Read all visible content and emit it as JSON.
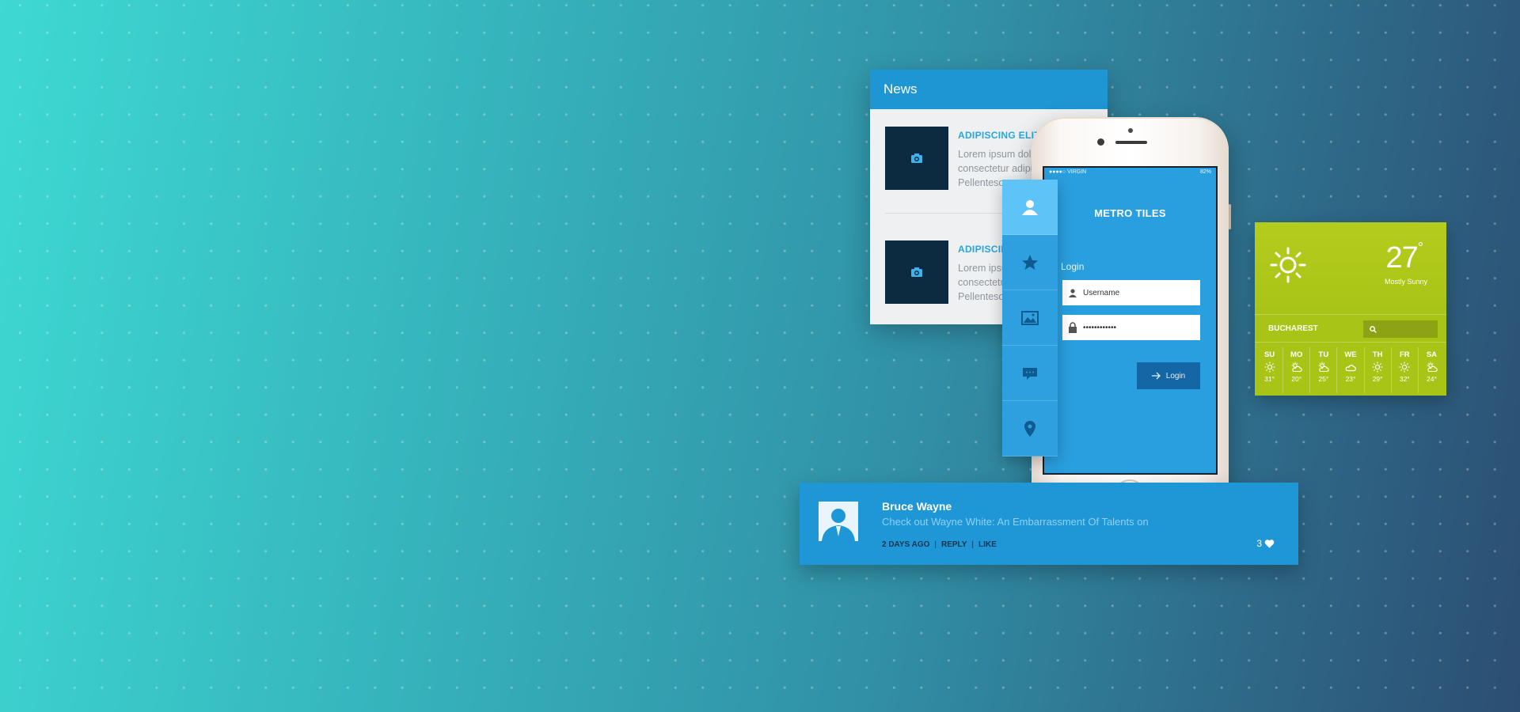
{
  "news": {
    "header": "News",
    "items": [
      {
        "title": "ADIPISCING ELIT",
        "body": "Lorem ipsum dolor sit amet, consectetur adipiscing. Pellentesque"
      },
      {
        "title": "ADIPISCING ELIT",
        "body": "Lorem ipsum dolor sit amet, consectetur adipiscing. Pellentesque"
      }
    ]
  },
  "phone": {
    "status": {
      "carrier": "●●●●○ VIRGIN",
      "battery": "82%"
    },
    "brand": "METRO TILES",
    "login_label": "Login",
    "username_placeholder": "Username",
    "password_value": "••••••••••••",
    "login_button": "Login"
  },
  "side_tabs": [
    "user-icon",
    "star-icon",
    "image-icon",
    "chat-icon",
    "location-pin-icon"
  ],
  "weather": {
    "temperature": "27",
    "degree": "°",
    "condition": "Mostly Sunny",
    "city": "BUCHAREST",
    "days": [
      {
        "day": "SU",
        "temp": "31°",
        "icon": "sun-icon"
      },
      {
        "day": "MO",
        "temp": "20°",
        "icon": "cloudy-sun-icon"
      },
      {
        "day": "TU",
        "temp": "25°",
        "icon": "cloudy-sun-icon"
      },
      {
        "day": "WE",
        "temp": "23°",
        "icon": "cloud-icon"
      },
      {
        "day": "TH",
        "temp": "29°",
        "icon": "sun-icon"
      },
      {
        "day": "FR",
        "temp": "32°",
        "icon": "sun-icon"
      },
      {
        "day": "SA",
        "temp": "24°",
        "icon": "cloudy-sun-icon"
      }
    ]
  },
  "comment": {
    "name": "Bruce Wayne",
    "text": "Check out Wayne White: An Embarrassment Of Talents on",
    "time": "2 DAYS AGO",
    "reply": "REPLY",
    "like": "LIKE",
    "likes": "3"
  },
  "colors": {
    "accent": "#1f97d6",
    "weather": "#a8c416",
    "dark": "#0c2a40"
  }
}
